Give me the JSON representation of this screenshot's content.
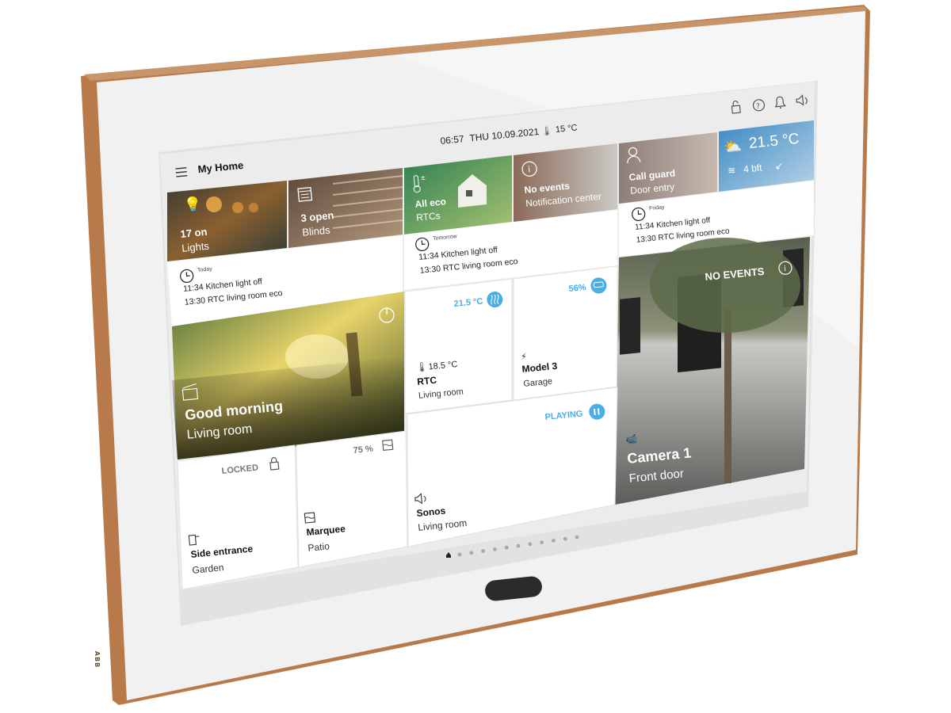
{
  "device": {
    "brand_mark": "ABB",
    "frame_color": "#b87a4b",
    "bezel_color": "#f2f2f2"
  },
  "status_bar": {
    "time": "06:57",
    "date": "THU 10.09.2021",
    "outdoor_temp": "15 °C",
    "icons": [
      "lock-open-icon",
      "help-icon",
      "bell-icon",
      "volume-icon"
    ]
  },
  "app_bar": {
    "menu_icon": "hamburger-icon",
    "title": "My Home"
  },
  "accent_color": "#4aaee6",
  "tiles": {
    "lights": {
      "value": "17 on",
      "label": "Lights",
      "icon": "lightbulb-icon"
    },
    "blinds": {
      "value": "3 open",
      "label": "Blinds",
      "icon": "blinds-icon"
    },
    "rtcs": {
      "value": "All eco",
      "label": "RTCs",
      "icon": "thermostat-icon"
    },
    "notifications": {
      "value": "No events",
      "label": "Notification center",
      "icon": "info-icon"
    },
    "door_entry": {
      "value": "Call guard",
      "label": "Door entry",
      "icon": "person-icon"
    },
    "weather": {
      "temperature": "21.5 °C",
      "wind": "4 bft",
      "icon": "partly-sunny-icon",
      "wind_icon": "wind-icon",
      "direction_icon": "arrow-southwest-icon"
    },
    "timer_today": {
      "day": "Today",
      "events": [
        "11:34 Kitchen light off",
        "13:30 RTC living room eco"
      ]
    },
    "timer_tomorrow": {
      "day": "Tomorrow",
      "events": [
        "11:34 Kitchen light off",
        "13:30 RTC living room eco"
      ]
    },
    "timer_friday": {
      "day": "Friday",
      "events": [
        "11:34 Kitchen light off",
        "13:30 RTC living room eco"
      ]
    },
    "scene": {
      "title": "Good morning",
      "subtitle": "Living room",
      "icon": "scene-icon",
      "power_icon": "power-icon"
    },
    "rtc": {
      "setpoint": "21.5 °C",
      "current": "18.5 °C",
      "title": "RTC",
      "subtitle": "Living room"
    },
    "ev_charger": {
      "percent": "56%",
      "title": "Model 3",
      "subtitle": "Garage"
    },
    "camera": {
      "status": "NO EVENTS",
      "title": "Camera 1",
      "subtitle": "Front door"
    },
    "lock": {
      "status": "LOCKED",
      "title": "Side entrance",
      "subtitle": "Garden"
    },
    "marquee": {
      "percent": "75 %",
      "title": "Marquee",
      "subtitle": "Patio"
    },
    "sonos": {
      "status": "PLAYING",
      "title": "Sonos",
      "subtitle": "Living room"
    }
  },
  "pagination": {
    "current": 1,
    "total_dots": 11
  }
}
